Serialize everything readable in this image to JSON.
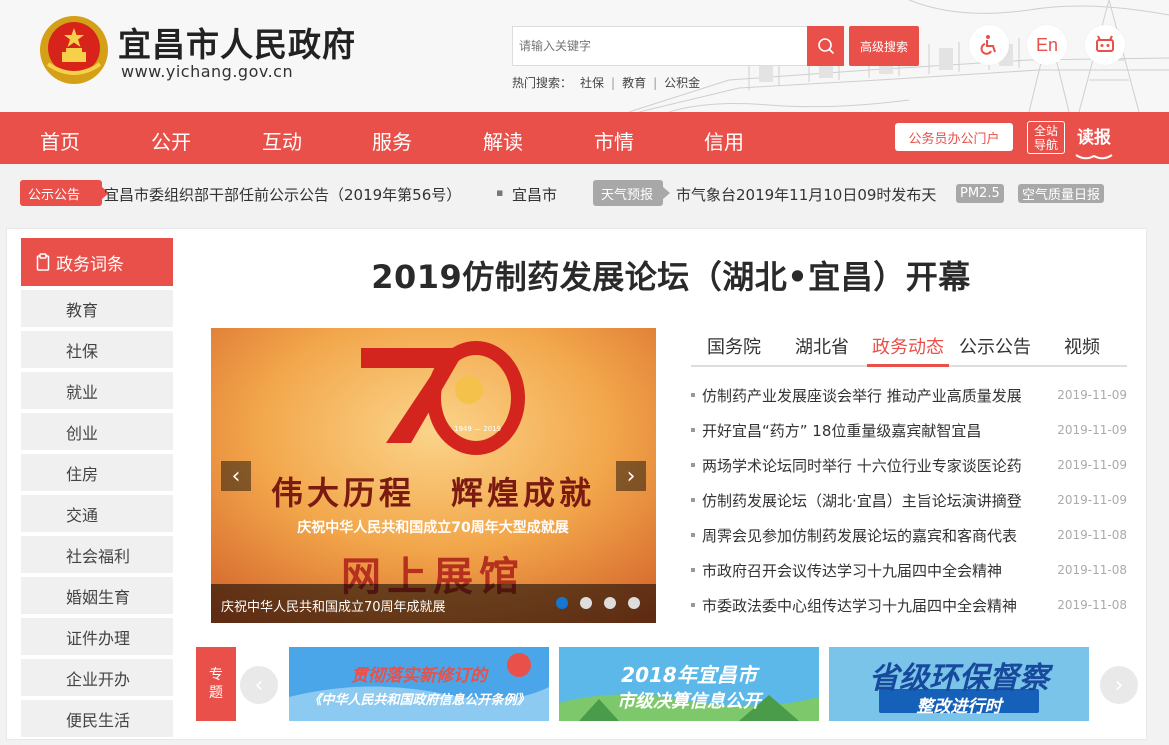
{
  "header": {
    "title": "宜昌市人民政府",
    "url": "www.yichang.gov.cn",
    "search_placeholder": "请输入关键字",
    "advanced_search": "高级搜索",
    "hot_label": "热门搜索：",
    "hot_keywords": [
      "社保",
      "教育",
      "公积金"
    ],
    "english_btn": "En"
  },
  "nav": {
    "items": [
      "首页",
      "公开",
      "互动",
      "服务",
      "解读",
      "市情",
      "信用"
    ],
    "portal": "公务员办公门户",
    "guide": [
      "全站",
      "导航"
    ],
    "read": "读报"
  },
  "notice": {
    "tag": "公示公告",
    "text": "宜昌市委组织部干部任前公示公告（2019年第56号）",
    "text2": "宜昌市",
    "weather_tag": "天气预报",
    "weather_text": "市气象台2019年11月10日09时发布天",
    "pm": "PM2.5",
    "air": "空气质量日报"
  },
  "sidebar": {
    "title": "政务词条",
    "items": [
      "教育",
      "社保",
      "就业",
      "创业",
      "住房",
      "交通",
      "社会福利",
      "婚姻生育",
      "证件办理",
      "企业开办",
      "便民生活"
    ]
  },
  "headline": "2019仿制药发展论坛（湖北•宜昌）开幕",
  "slider": {
    "caption": "庆祝中华人民共和国成立70周年成就展",
    "poster_line1": "伟大历程　辉煌成就",
    "poster_line2": "庆祝中华人民共和国成立70周年大型成就展",
    "poster_line3": "网上展馆",
    "poster_years": "1949 — 2019",
    "slide_count": 4,
    "active_slide": 1
  },
  "tabs": {
    "items": [
      "国务院",
      "湖北省",
      "政务动态",
      "公示公告",
      "视频"
    ],
    "active": "政务动态"
  },
  "news": [
    {
      "title": "仿制药产业发展座谈会举行 推动产业高质量发展",
      "date": "2019-11-09"
    },
    {
      "title": "开好宜昌“药方” 18位重量级嘉宾献智宜昌",
      "date": "2019-11-09"
    },
    {
      "title": "两场学术论坛同时举行 十六位行业专家谈医论药",
      "date": "2019-11-09"
    },
    {
      "title": "仿制药发展论坛（湖北·宜昌）主旨论坛演讲摘登",
      "date": "2019-11-09"
    },
    {
      "title": "周霁会见参加仿制药发展论坛的嘉宾和客商代表",
      "date": "2019-11-08"
    },
    {
      "title": "市政府召开会议传达学习十九届四中全会精神",
      "date": "2019-11-08"
    },
    {
      "title": "市委政法委中心组传达学习十九届四中全会精神",
      "date": "2019-11-08"
    }
  ],
  "topics": {
    "label": [
      "专",
      "题"
    ],
    "banners": [
      {
        "line1": "贯彻落实新修订的",
        "line2": "《中华人民共和国政府信息公开条例》"
      },
      {
        "line1": "2018年宜昌市",
        "line2": "市级决算信息公开"
      },
      {
        "line1": "省级环保督察",
        "line2": "整改进行时"
      }
    ]
  },
  "colors": {
    "brand_red": "#e9504a",
    "active_dot": "#1677d3"
  }
}
